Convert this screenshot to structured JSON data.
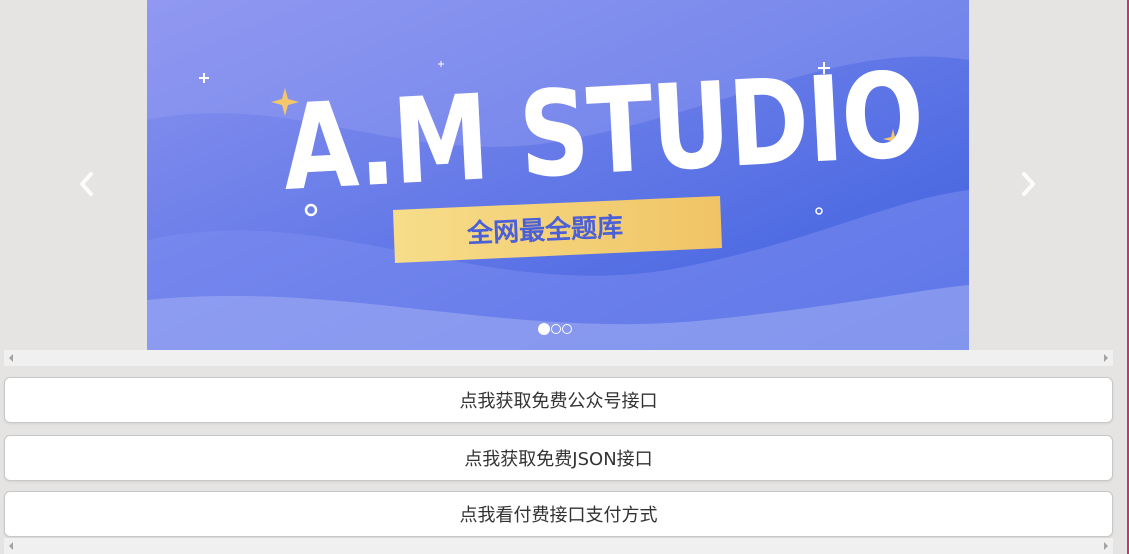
{
  "banner": {
    "title": "A.M STUDIO",
    "subtitle": "全网最全题库",
    "slide_count": 3,
    "active_slide": 1
  },
  "buttons": [
    {
      "label": "点我获取免费公众号接口"
    },
    {
      "label": "点我获取免费JSON接口"
    },
    {
      "label": "点我看付费接口支付方式"
    }
  ],
  "colors": {
    "banner_blue": "#5b6fe8",
    "tag_gold": "#f2cf6f",
    "page_bg": "#e6e4e2"
  }
}
